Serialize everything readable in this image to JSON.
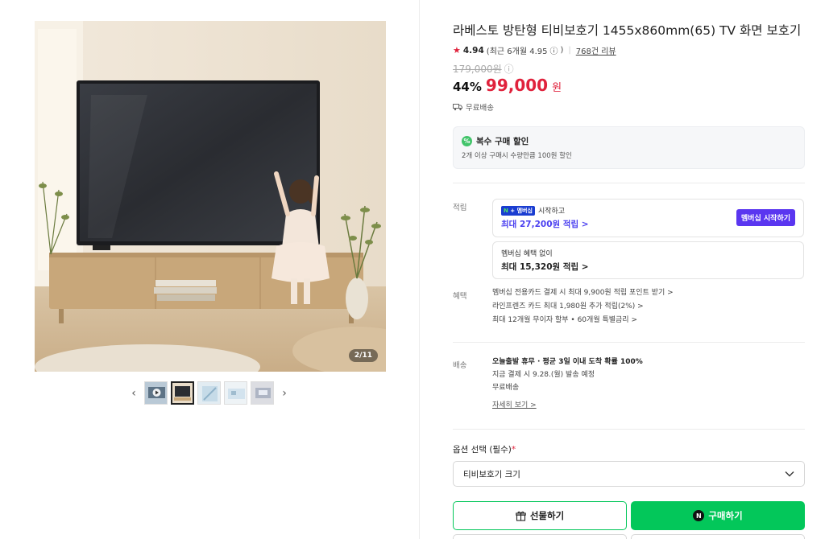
{
  "gallery": {
    "page_indicator": "2/11",
    "prev_icon": "chevron-left-icon",
    "next_icon": "chevron-right-icon"
  },
  "product": {
    "title": "라베스토 방탄형 티비보호기 1455x860mm(65) TV 화면 보호기",
    "rating": "4.94",
    "rating_recent": "(최근 6개월 4.95",
    "rating_recent_close": ")",
    "review_link": "768건 리뷰",
    "original_price": "179,000원",
    "discount": "44%",
    "sale_price": "99,000",
    "currency": "원",
    "shipping": "무료배송"
  },
  "multi_discount": {
    "title": "복수 구매 할인",
    "description": "2개 이상 구매시 수량만큼 100원 할인"
  },
  "points": {
    "label": "적립",
    "membership_badge_n": "N",
    "membership_badge_text": "멤버십",
    "membership_start": "시작하고",
    "max_with_membership": "최대 27,200원 적립 >",
    "member_button": "멤버십 시작하기",
    "without_title": "멤버십 혜택 없이",
    "max_without": "최대 15,320원 적립 >"
  },
  "benefits": {
    "label": "혜택",
    "items": [
      "멤버십 전용카드 결제 시 최대 9,900원 적립 포인트 받기 >",
      "라인프렌즈 카드 최대 1,980원 추가 적립(2%) >",
      "최대 12개월 무이자 할부 • 60개월 특별금리 >"
    ]
  },
  "delivery": {
    "label": "배송",
    "line1": "오늘출발 휴무 · 평균 3일 이내 도착 확률 100%",
    "line2": "지금 결제 시 9.28.(월) 발송 예정",
    "line3": "무료배송",
    "detail_link": "자세히 보기 >"
  },
  "options": {
    "label": "옵션 선택 (필수)",
    "required_mark": "*",
    "select_value": "티비보호기 크기"
  },
  "actions": {
    "gift": "선물하기",
    "buy": "구매하기"
  },
  "colors": {
    "accent_red": "#e0223c",
    "naver_green": "#03c75a",
    "membership_purple": "#5a36f0"
  }
}
